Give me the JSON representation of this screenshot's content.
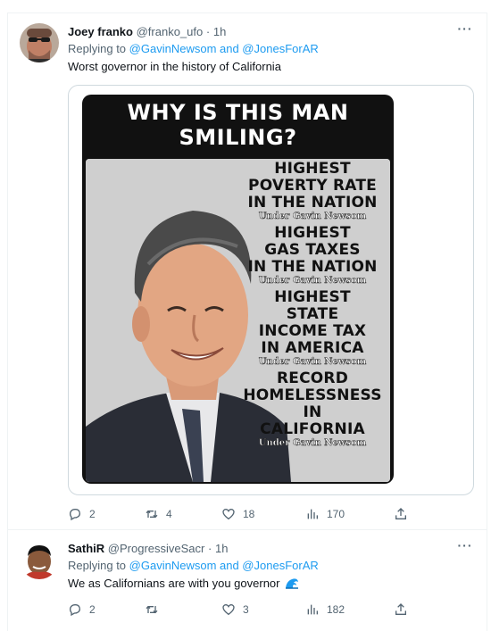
{
  "tweets": [
    {
      "author_name": "Joey franko",
      "handle": "@franko_ufo",
      "separator": "·",
      "time": "1h",
      "replying_prefix": "Replying to",
      "replying_to": "@GavinNewsom and @JonesForAR",
      "text": "Worst governor in the history of California",
      "more_label": "···",
      "stats": {
        "replies": "2",
        "retweets": "4",
        "likes": "18",
        "views": "170"
      }
    },
    {
      "author_name": "SathiR",
      "handle": "@ProgressiveSacr",
      "separator": "·",
      "time": "1h",
      "replying_prefix": "Replying to",
      "replying_to": "@GavinNewsom and @JonesForAR",
      "text": "We as Californians are with you governor",
      "emoji": "wave-emoji",
      "more_label": "···",
      "stats": {
        "replies": "2",
        "retweets": "",
        "likes": "3",
        "views": "182"
      }
    }
  ],
  "meme": {
    "title_line1": "WHY IS THIS MAN",
    "title_line2": "SMILING?",
    "claims": [
      {
        "lines": [
          "HIGHEST",
          "POVERTY RATE",
          "IN THE NATION"
        ],
        "under": "Under Gavin Newsom"
      },
      {
        "lines": [
          "HIGHEST",
          "GAS TAXES",
          "IN THE NATION"
        ],
        "under": "Under Gavin Newsom"
      },
      {
        "lines": [
          "HIGHEST",
          "STATE",
          "INCOME TAX",
          "IN AMERICA"
        ],
        "under": "Under Gavin Newsom"
      },
      {
        "lines": [
          "RECORD",
          "HOMELESSNESS",
          "IN",
          "CALIFORNIA"
        ],
        "under": "Under Gavin Newsom"
      }
    ]
  },
  "icons": {
    "reply": "reply-icon",
    "retweet": "retweet-icon",
    "like": "heart-icon",
    "views": "views-icon",
    "share": "share-icon",
    "more": "more-icon"
  },
  "colors": {
    "link": "#1d9bf0",
    "muted": "#536471",
    "border": "#eff3f4",
    "text": "#0f1419"
  }
}
